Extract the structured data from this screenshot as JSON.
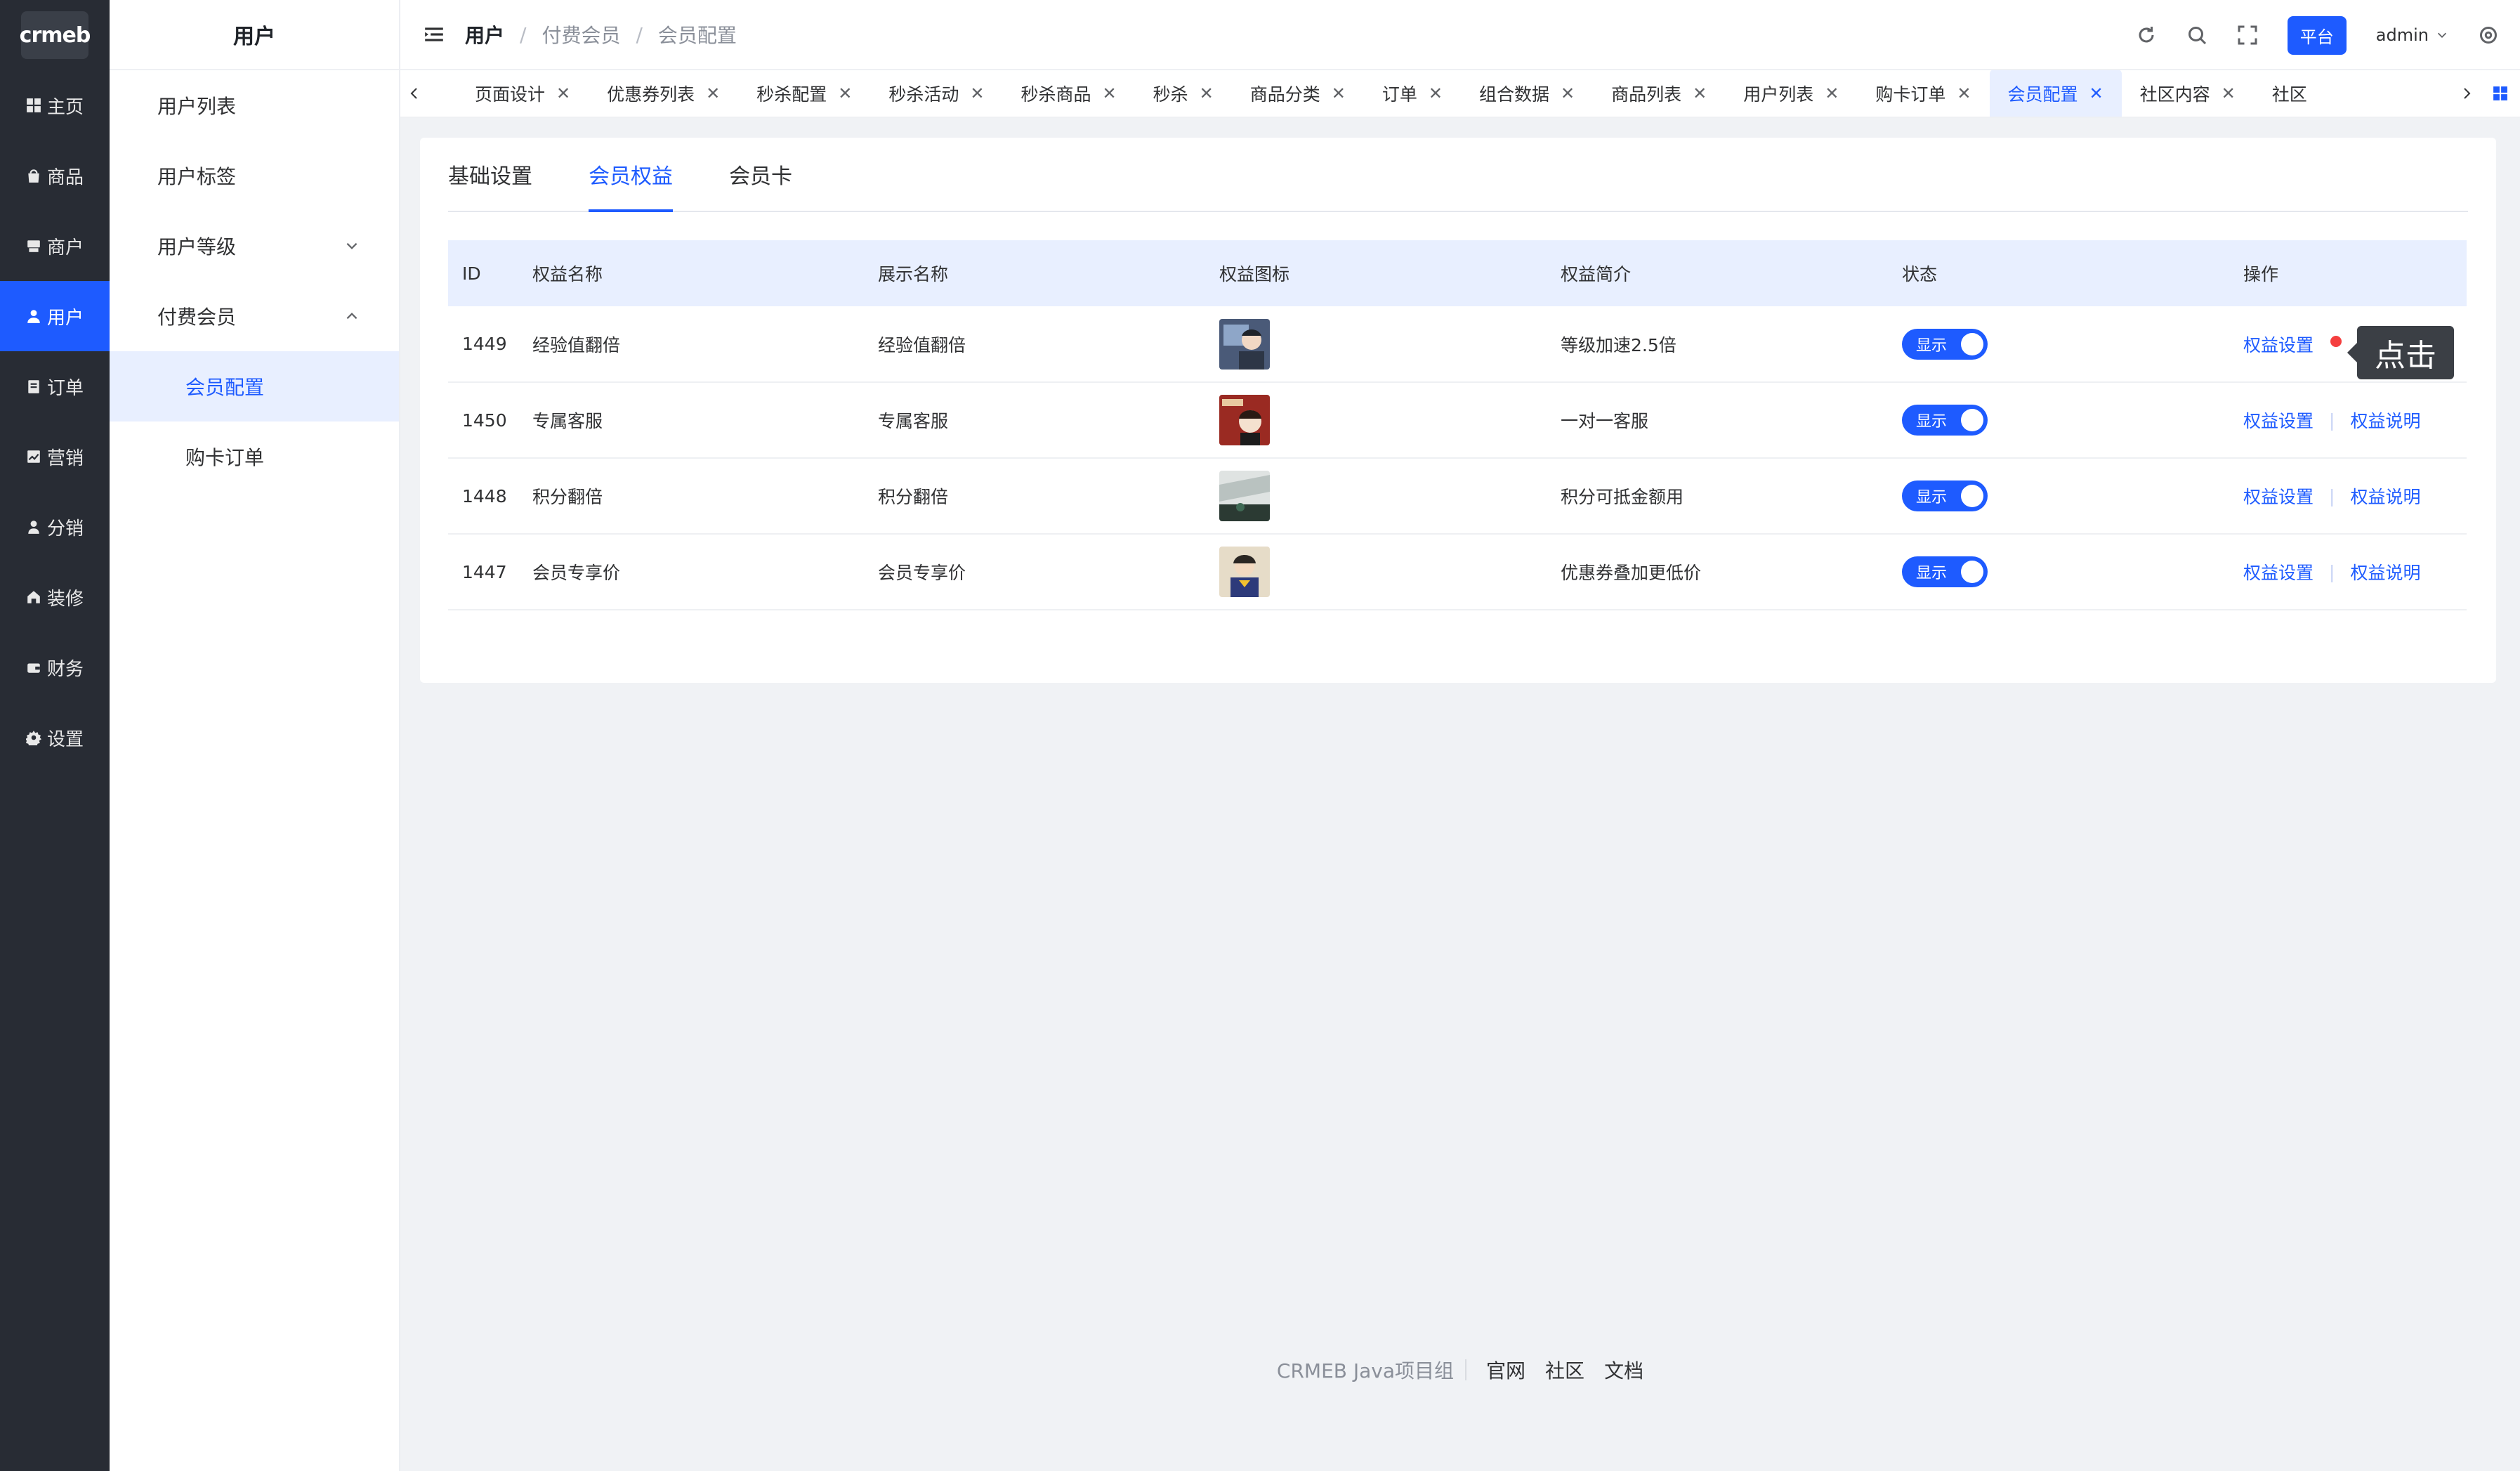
{
  "logo": "crmeb",
  "rail": [
    {
      "label": "主页",
      "icon": "grid-icon"
    },
    {
      "label": "商品",
      "icon": "bag-icon"
    },
    {
      "label": "商户",
      "icon": "store-icon"
    },
    {
      "label": "用户",
      "icon": "user-icon",
      "active": true
    },
    {
      "label": "订单",
      "icon": "clipboard-icon"
    },
    {
      "label": "营销",
      "icon": "chart-icon"
    },
    {
      "label": "分销",
      "icon": "person-icon"
    },
    {
      "label": "装修",
      "icon": "home-icon"
    },
    {
      "label": "财务",
      "icon": "wallet-icon"
    },
    {
      "label": "设置",
      "icon": "gear-icon"
    }
  ],
  "subnav": {
    "title": "用户",
    "items": [
      "用户列表",
      "用户标签",
      "用户等级",
      "付费会员",
      "会员配置",
      "购卡订单"
    ]
  },
  "header": {
    "breadcrumb": [
      "用户",
      "付费会员",
      "会员配置"
    ],
    "platform": "平台",
    "user": "admin"
  },
  "tabs": [
    "页面设计",
    "优惠券列表",
    "秒杀配置",
    "秒杀活动",
    "秒杀商品",
    "秒杀",
    "商品分类",
    "订单",
    "组合数据",
    "商品列表",
    "用户列表",
    "购卡订单",
    "会员配置",
    "社区内容",
    "社区"
  ],
  "inner_tabs": [
    "基础设置",
    "会员权益",
    "会员卡"
  ],
  "table": {
    "columns": [
      "ID",
      "权益名称",
      "展示名称",
      "权益图标",
      "权益简介",
      "状态",
      "操作"
    ],
    "rows": [
      {
        "id": "1449",
        "name": "经验值翻倍",
        "display": "经验值翻倍",
        "desc": "等级加速2.5倍",
        "status": "显示"
      },
      {
        "id": "1450",
        "name": "专属客服",
        "display": "专属客服",
        "desc": "一对一客服",
        "status": "显示"
      },
      {
        "id": "1448",
        "name": "积分翻倍",
        "display": "积分翻倍",
        "desc": "积分可抵金额用",
        "status": "显示"
      },
      {
        "id": "1447",
        "name": "会员专享价",
        "display": "会员专享价",
        "desc": "优惠券叠加更低价",
        "status": "显示"
      }
    ],
    "op_setting": "权益设置",
    "op_desc": "权益说明"
  },
  "tooltip": "点击",
  "footer": {
    "team": "CRMEB Java项目组",
    "links": [
      "官网",
      "社区",
      "文档"
    ]
  },
  "colors": {
    "primary": "#1e5bff",
    "rail_bg": "#282c34",
    "active_bg": "#e8efff"
  }
}
